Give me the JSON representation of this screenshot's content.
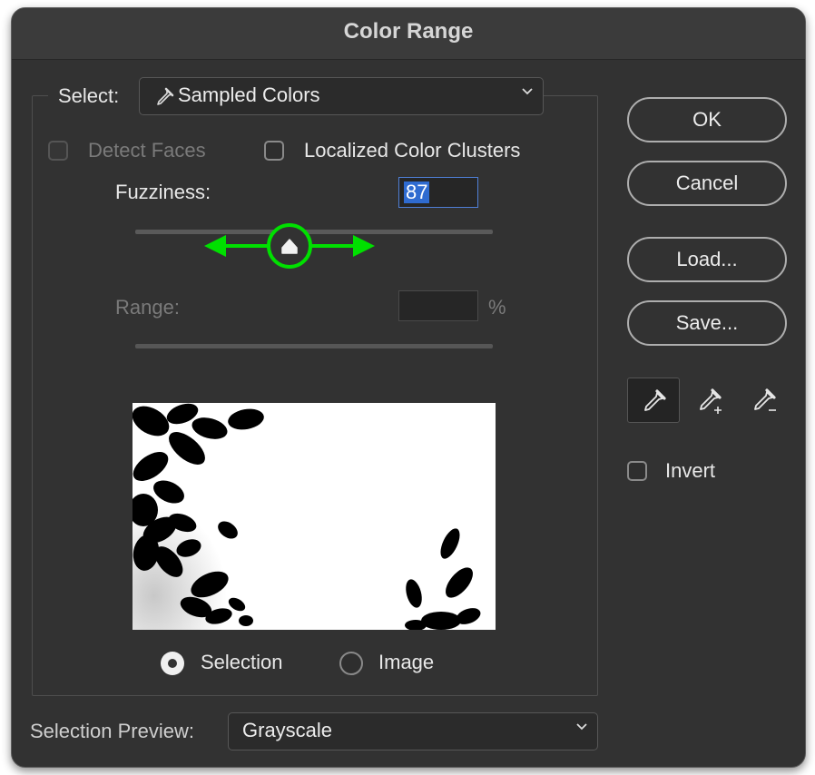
{
  "dialog": {
    "title": "Color Range"
  },
  "select": {
    "label": "Select:",
    "value": "Sampled Colors"
  },
  "detect_faces": {
    "label": "Detect Faces",
    "checked": false,
    "enabled": false
  },
  "localized_clusters": {
    "label": "Localized Color Clusters",
    "checked": false
  },
  "fuzziness": {
    "label": "Fuzziness:",
    "value": "87",
    "slider_fraction": 0.43
  },
  "range": {
    "label": "Range:",
    "value": "",
    "unit": "%"
  },
  "preview_mode": {
    "options": [
      {
        "label": "Selection",
        "selected": true
      },
      {
        "label": "Image",
        "selected": false
      }
    ]
  },
  "selection_preview": {
    "label": "Selection Preview:",
    "value": "Grayscale"
  },
  "buttons": {
    "ok": "OK",
    "cancel": "Cancel",
    "load": "Load...",
    "save": "Save..."
  },
  "eyedroppers": [
    "eyedropper-icon",
    "eyedropper-add-icon",
    "eyedropper-subtract-icon"
  ],
  "invert": {
    "label": "Invert",
    "checked": false
  },
  "colors": {
    "highlight": "#2f6bd0",
    "annotation": "#00e000",
    "dialog_bg": "#323232"
  }
}
